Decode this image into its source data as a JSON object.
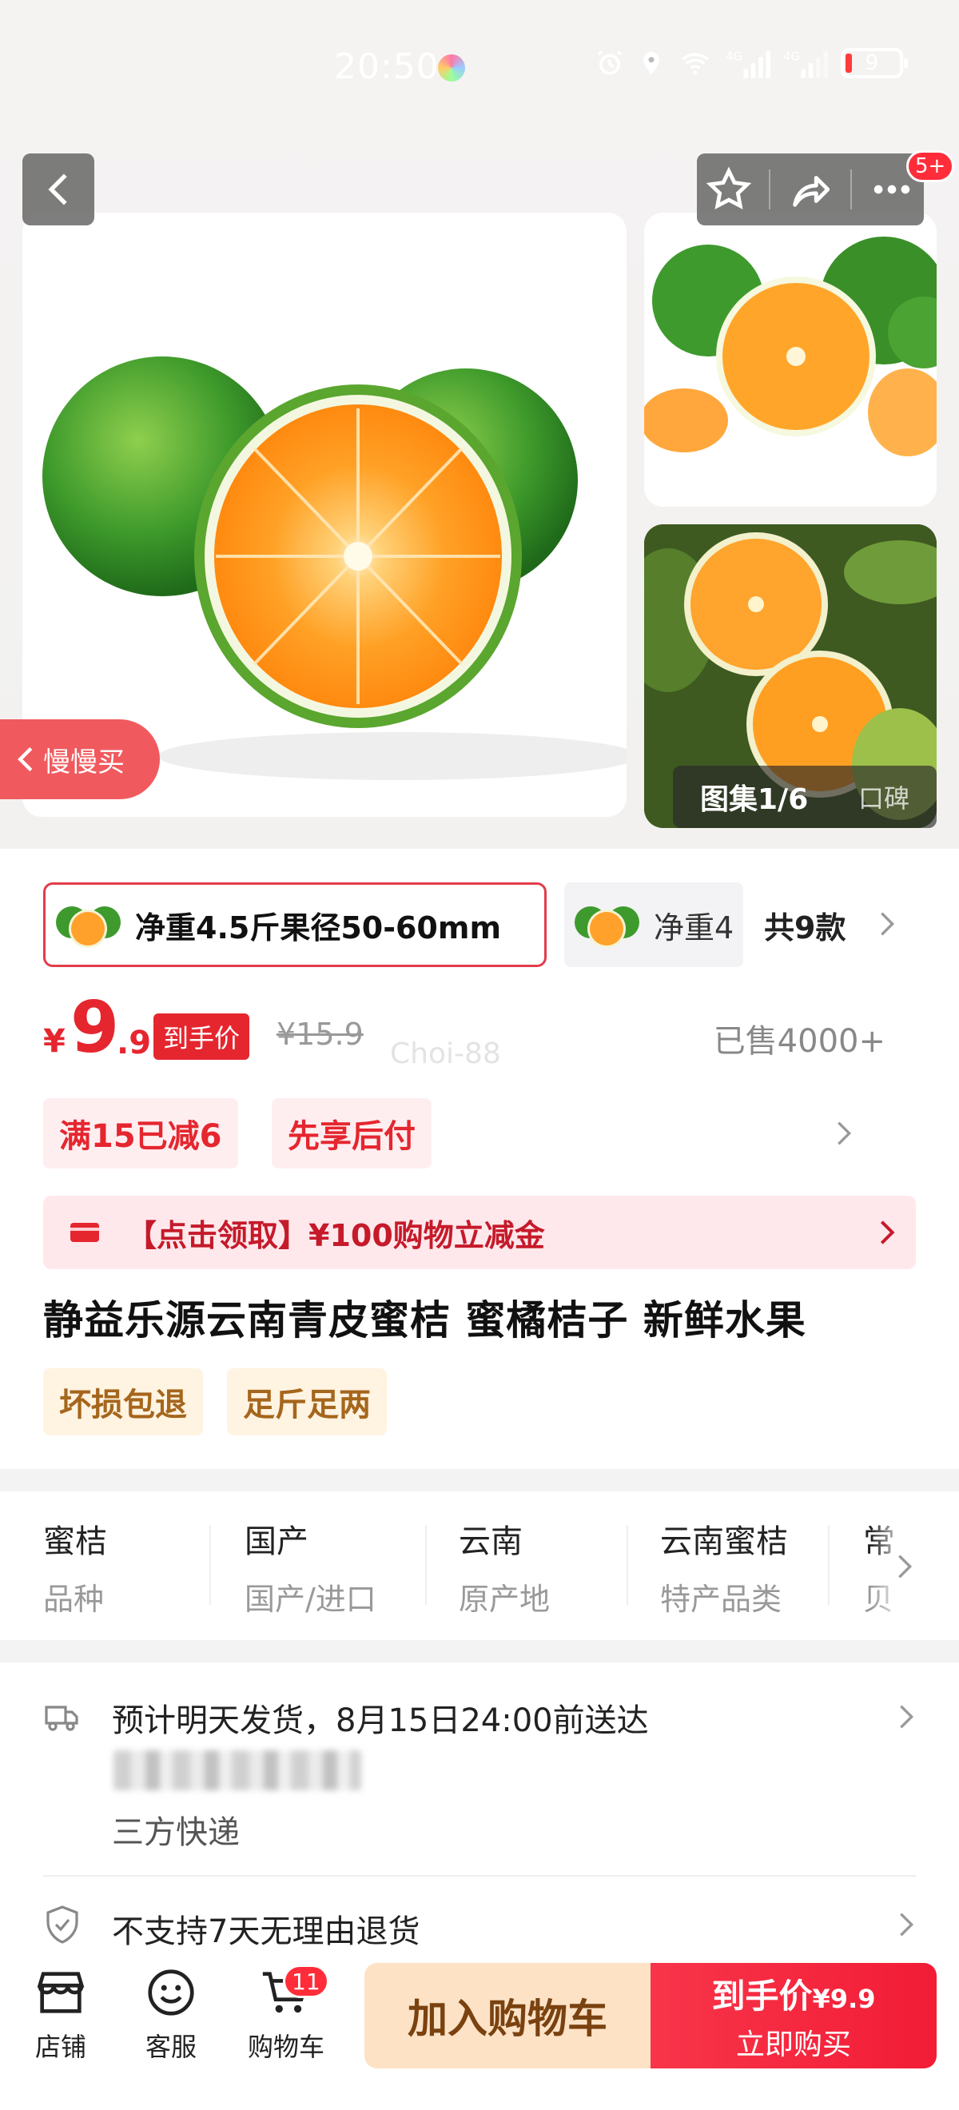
{
  "status_bar": {
    "time": "20:50",
    "battery": "9"
  },
  "top_actions": {
    "cart_count_badge": "5+"
  },
  "gallery": {
    "label": "图集1/6",
    "reviews_tab": "口碑"
  },
  "slow_buy": {
    "label": "慢慢买"
  },
  "sku": {
    "active_label": "净重4.5斤果径50-60mm",
    "other_label": "净重4",
    "count_label": "共9款"
  },
  "price": {
    "currency": "¥",
    "integer": "9",
    "decimal": ".9",
    "final_tag": "到手价",
    "original": "¥15.9",
    "watermark": "Choi-88",
    "sold": "已售4000+"
  },
  "promos": [
    "满15已减6",
    "先享后付"
  ],
  "coupon": {
    "label": "【点击领取】¥100购物立减金"
  },
  "product": {
    "title": "静益乐源云南青皮蜜桔 蜜橘桔子 新鲜水果",
    "tags": [
      "坏损包退",
      "足斤足两"
    ]
  },
  "attributes": [
    {
      "value": "蜜桔",
      "key": "品种"
    },
    {
      "value": "国产",
      "key": "国产/进口"
    },
    {
      "value": "云南",
      "key": "原产地"
    },
    {
      "value": "云南蜜桔",
      "key": "特产品类"
    },
    {
      "value": "常",
      "key": "贝"
    }
  ],
  "service": {
    "shipping": "预计明天发货，8月15日24:00前送达",
    "carrier": "三方快递",
    "returns": "不支持7天无理由退货"
  },
  "bottom_bar": {
    "shop": "店铺",
    "support": "客服",
    "cart": "购物车",
    "cart_count": "11",
    "add_to_cart": "加入购物车",
    "buy_price_label": "到手价",
    "buy_price": "¥9.9",
    "buy_now": "立即购买"
  },
  "colors": {
    "accent_red": "#e5262f",
    "cart_button": "#fde2c6",
    "buy_button": "#f21c36"
  }
}
